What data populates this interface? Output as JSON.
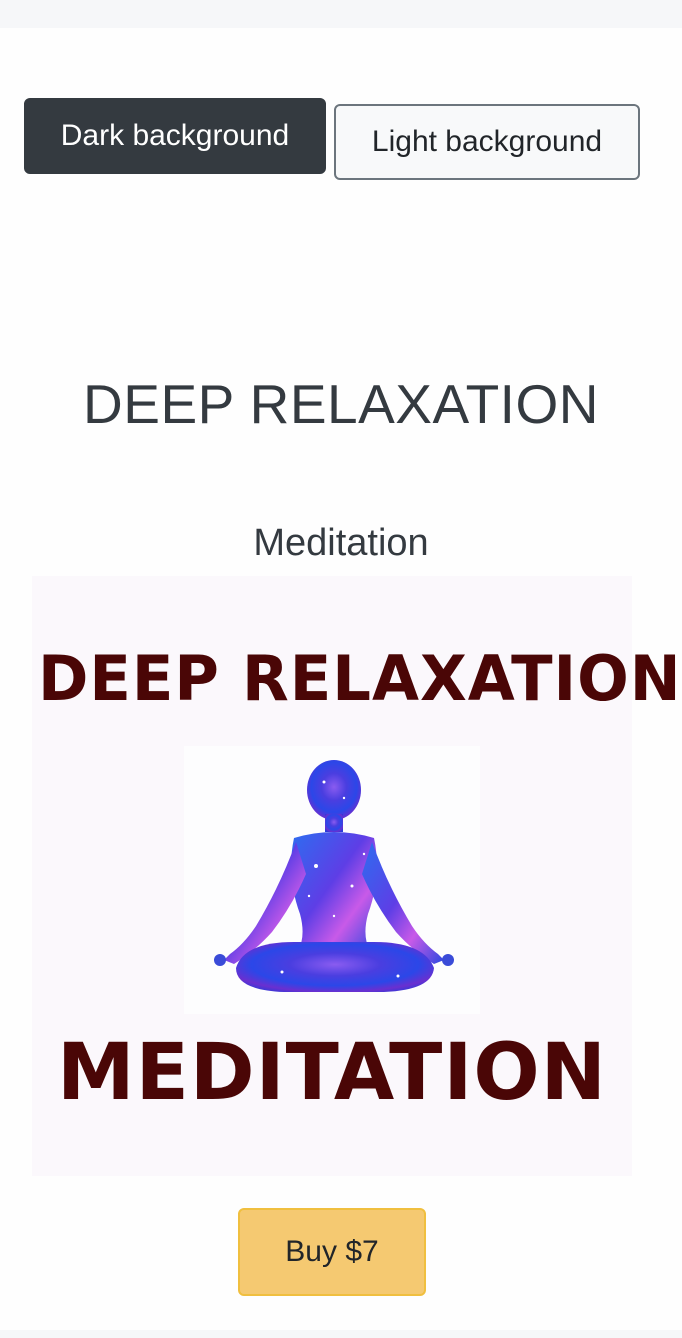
{
  "toolbar": {
    "dark_label": "Dark background",
    "light_label": "Light background"
  },
  "product": {
    "title": "DEEP RELAXATION",
    "subtitle": "Meditation",
    "image": {
      "top_text": "DEEP RELAXATION",
      "bottom_text": "MEDITATION",
      "figure_icon": "meditation-figure-icon",
      "text_color": "#4a0606"
    },
    "buy_label": "Buy $7"
  },
  "colors": {
    "dark_button": "#343a40",
    "light_button": "#f8f9fa",
    "buy_button": "#f5c971",
    "title_text": "#343a40"
  }
}
